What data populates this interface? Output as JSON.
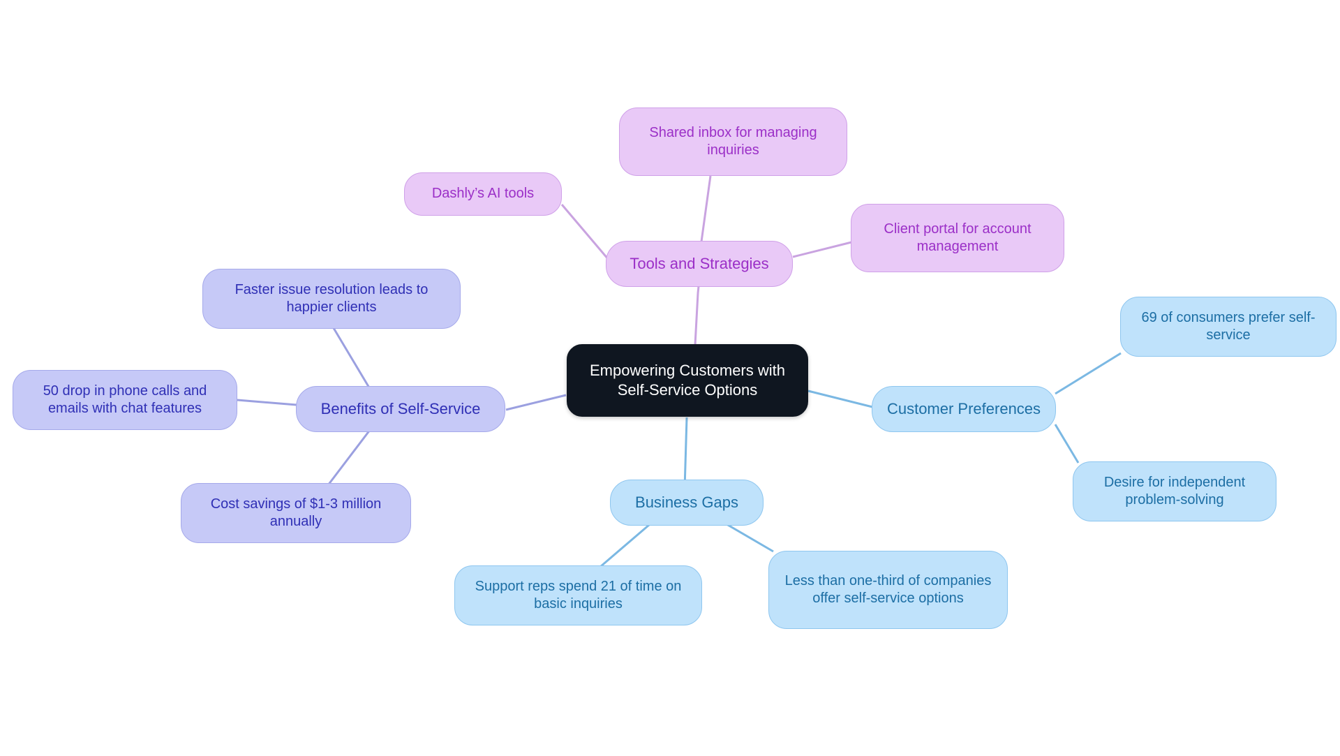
{
  "diagram": {
    "type": "mindmap",
    "background": "#ffffff",
    "root": {
      "id": "root",
      "label": "Empowering Customers with Self-Service Options",
      "fill": "#0f1620",
      "text_color": "#ffffff"
    },
    "branches": [
      {
        "id": "tools-and-strategies",
        "label": "Tools and Strategies",
        "fill": "#e9c9f7",
        "border": "#cfa0e8",
        "text_color": "#9b2fc7",
        "children": [
          {
            "id": "dashly-ai-tools",
            "label": "Dashly’s AI tools"
          },
          {
            "id": "shared-inbox",
            "label": "Shared inbox for managing inquiries"
          },
          {
            "id": "client-portal",
            "label": "Client portal for account management"
          }
        ]
      },
      {
        "id": "benefits-of-self-service",
        "label": "Benefits of Self-Service",
        "fill": "#c6c9f7",
        "border": "#a5a9ea",
        "text_color": "#2f2fb5",
        "children": [
          {
            "id": "faster-issue-resolution",
            "label": "Faster issue resolution leads to happier clients"
          },
          {
            "id": "drop-in-phone-calls",
            "label": "50 drop in phone calls and emails with chat features"
          },
          {
            "id": "cost-savings",
            "label": "Cost savings of $1-3 million annually"
          }
        ]
      },
      {
        "id": "customer-preferences",
        "label": "Customer Preferences",
        "fill": "#bfe2fb",
        "border": "#8ec6ef",
        "text_color": "#1c6ea4",
        "children": [
          {
            "id": "consumers-prefer-self-service",
            "label": "69 of consumers prefer self-service"
          },
          {
            "id": "independent-problem-solving",
            "label": "Desire for independent problem-solving"
          }
        ]
      },
      {
        "id": "business-gaps",
        "label": "Business Gaps",
        "fill": "#bfe2fb",
        "border": "#8ec6ef",
        "text_color": "#1c6ea4",
        "children": [
          {
            "id": "support-reps-time",
            "label": "Support reps spend 21 of time on basic inquiries"
          },
          {
            "id": "companies-offer-self-service",
            "label": "Less than one-third of companies offer self-service options"
          }
        ]
      }
    ],
    "edges": [
      {
        "from": "root",
        "to": "tools-and-strategies",
        "color": "#c9a3e0"
      },
      {
        "from": "tools-and-strategies",
        "to": "dashly-ai-tools",
        "color": "#c9a3e0"
      },
      {
        "from": "tools-and-strategies",
        "to": "shared-inbox",
        "color": "#c9a3e0"
      },
      {
        "from": "tools-and-strategies",
        "to": "client-portal",
        "color": "#c9a3e0"
      },
      {
        "from": "root",
        "to": "benefits-of-self-service",
        "color": "#9ba0e0"
      },
      {
        "from": "benefits-of-self-service",
        "to": "faster-issue-resolution",
        "color": "#9ba0e0"
      },
      {
        "from": "benefits-of-self-service",
        "to": "drop-in-phone-calls",
        "color": "#9ba0e0"
      },
      {
        "from": "benefits-of-self-service",
        "to": "cost-savings",
        "color": "#9ba0e0"
      },
      {
        "from": "root",
        "to": "customer-preferences",
        "color": "#7bb8e3"
      },
      {
        "from": "customer-preferences",
        "to": "consumers-prefer-self-service",
        "color": "#7bb8e3"
      },
      {
        "from": "customer-preferences",
        "to": "independent-problem-solving",
        "color": "#7bb8e3"
      },
      {
        "from": "root",
        "to": "business-gaps",
        "color": "#7bb8e3"
      },
      {
        "from": "business-gaps",
        "to": "support-reps-time",
        "color": "#7bb8e3"
      },
      {
        "from": "business-gaps",
        "to": "companies-offer-self-service",
        "color": "#7bb8e3"
      }
    ]
  }
}
